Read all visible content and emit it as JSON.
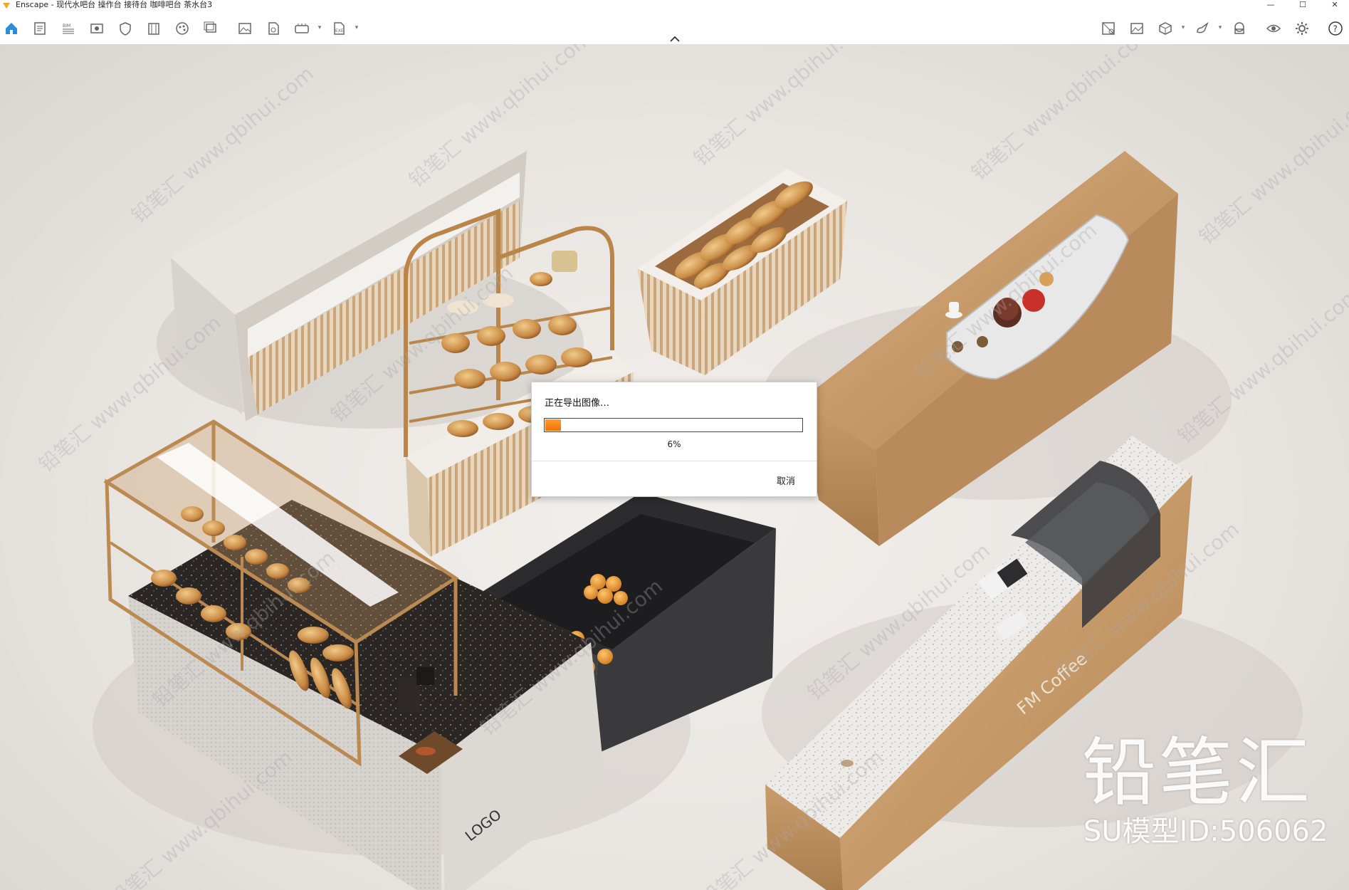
{
  "window": {
    "title": "Enscape - 现代水吧台 操作台 接待台 咖啡吧台 茶水台3",
    "controls": [
      "minimize",
      "maximize",
      "close"
    ]
  },
  "toolbar": {
    "left_icons": [
      "home-icon",
      "document-icon",
      "bim-icon",
      "view-icon",
      "shield-icon",
      "building-icon",
      "material-icon",
      "batch-render-icon",
      "image-icon",
      "file-export-icon",
      "panorama-icon",
      "exe-export-icon"
    ],
    "right_icons": [
      "visual-settings-icon",
      "capture-icon",
      "asset-library-icon",
      "upload-icon",
      "vr-headset-icon",
      "visibility-icon",
      "settings-icon",
      "help-icon"
    ],
    "help_label": "?",
    "collapse_glyph": "⌃"
  },
  "dialog": {
    "message": "正在导出图像…",
    "progress_percent": 6,
    "progress_label": "6%",
    "cancel_label": "取消"
  },
  "scene": {
    "logo_text": "LOGO",
    "counter_brand_text": "FM Coffee"
  },
  "watermark": {
    "brand": "铅笔汇",
    "model_id": "SU模型ID:506062",
    "tile_text": "铅笔汇 www.qbihui.com"
  },
  "colors": {
    "accent_orange": "#f2720a",
    "wood": "#c59a6c",
    "marble": "#e9e6e2",
    "terrazzo_dark": "#2a2624"
  }
}
